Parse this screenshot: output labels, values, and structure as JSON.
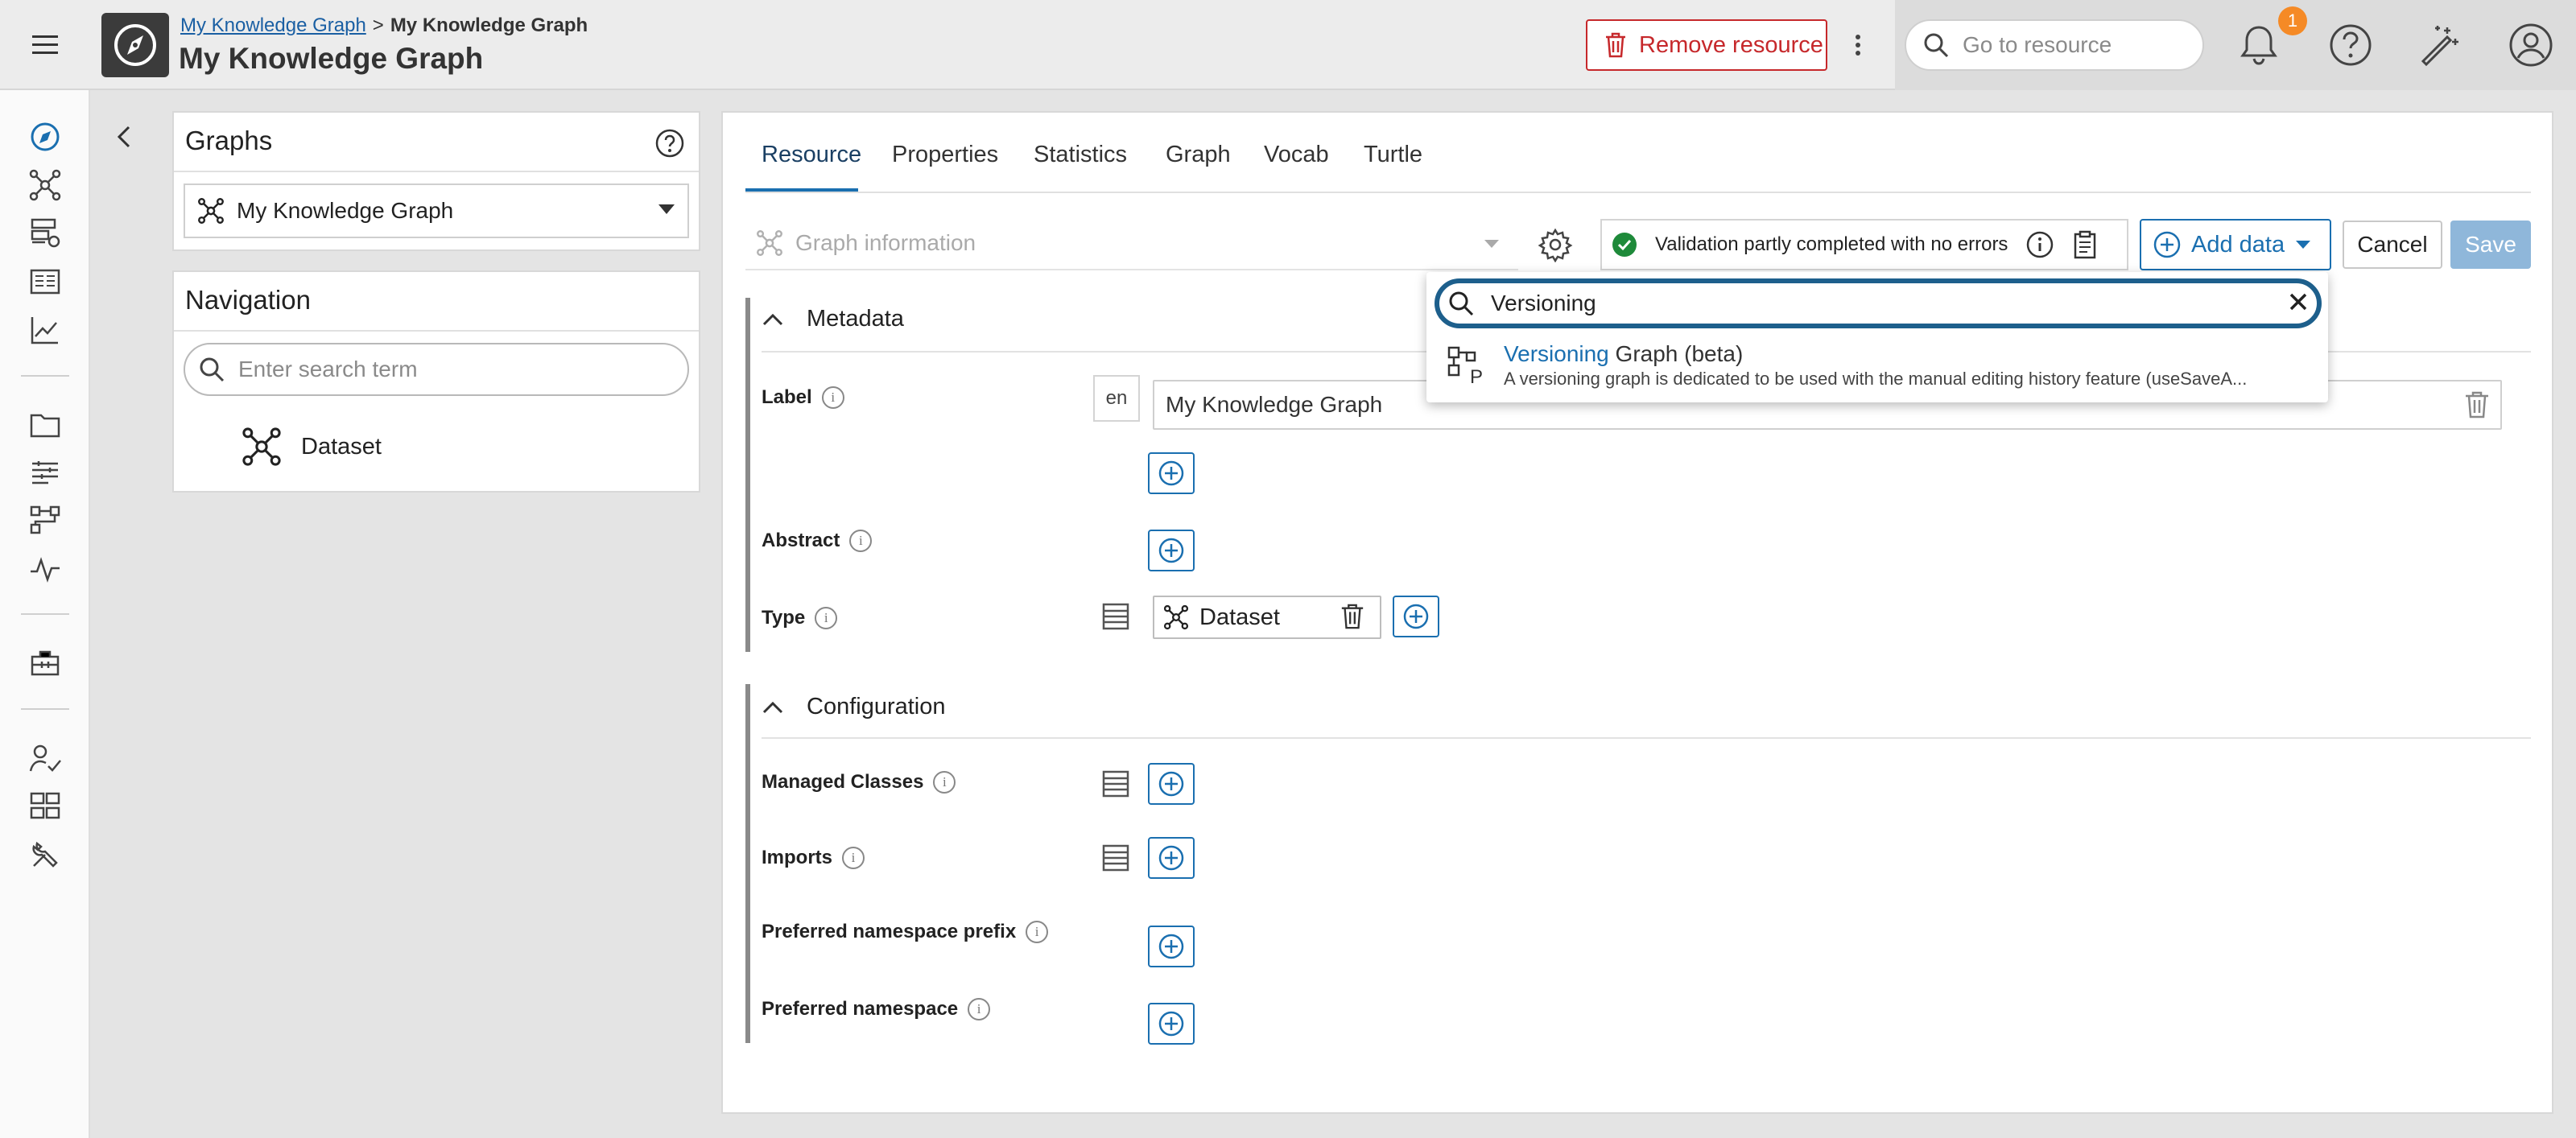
{
  "header": {
    "breadcrumb_link": "My Knowledge Graph",
    "breadcrumb_sep": ">",
    "breadcrumb_current": "My Knowledge Graph",
    "title": "My Knowledge Graph",
    "remove_label": "Remove resource",
    "goto_placeholder": "Go to resource",
    "notification_count": "1"
  },
  "graphs_panel": {
    "title": "Graphs",
    "selected_graph": "My Knowledge Graph"
  },
  "navigation_panel": {
    "title": "Navigation",
    "search_placeholder": "Enter search term",
    "items": [
      {
        "label": "Dataset"
      }
    ]
  },
  "tabs": [
    {
      "label": "Resource",
      "active": true
    },
    {
      "label": "Properties"
    },
    {
      "label": "Statistics"
    },
    {
      "label": "Graph"
    },
    {
      "label": "Vocab"
    },
    {
      "label": "Turtle"
    }
  ],
  "toolbar": {
    "graph_info_placeholder": "Graph information",
    "validation_text": "Validation partly completed with no errors",
    "add_data_label": "Add data",
    "cancel_label": "Cancel",
    "save_label": "Save"
  },
  "metadata": {
    "title": "Metadata",
    "label_field": "Label",
    "label_lang": "en",
    "label_value": "My Knowledge Graph",
    "abstract_field": "Abstract",
    "type_field": "Type",
    "type_value": "Dataset"
  },
  "configuration": {
    "title": "Configuration",
    "managed_classes": "Managed Classes",
    "imports": "Imports",
    "preferred_prefix": "Preferred namespace prefix",
    "preferred_namespace": "Preferred namespace"
  },
  "add_data_popup": {
    "search_value": "Versioning",
    "option_highlight": "Versioning",
    "option_rest": " Graph (beta)",
    "option_description": "A versioning graph is dedicated to be used with the manual editing history feature (useSaveA..."
  },
  "colors": {
    "accent": "#1a6fb0",
    "danger": "#c6282b",
    "badge": "#f58a26",
    "success": "#1e8a3a"
  }
}
